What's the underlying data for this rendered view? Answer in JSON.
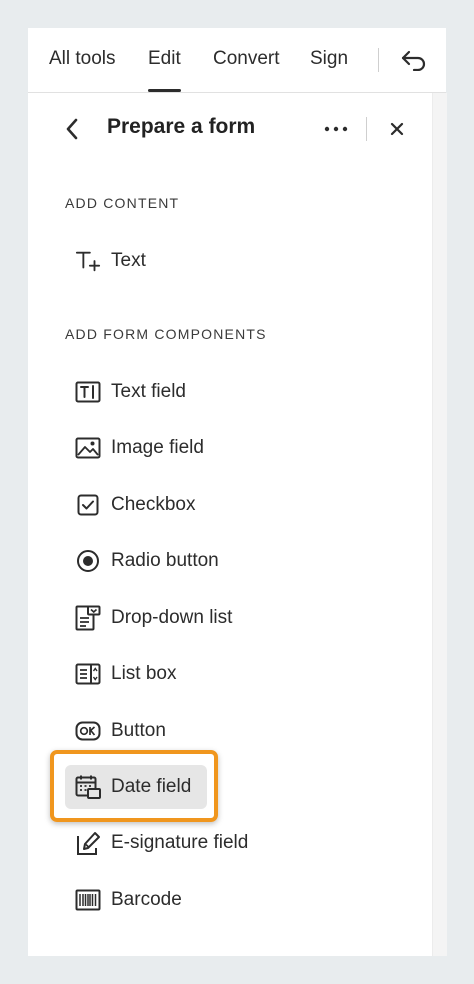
{
  "nav": {
    "tabs": [
      {
        "label": "All tools"
      },
      {
        "label": "Edit",
        "active": true
      },
      {
        "label": "Convert"
      },
      {
        "label": "Sign"
      }
    ],
    "undo_icon": "undo-icon"
  },
  "panel": {
    "title": "Prepare a form",
    "back_icon": "chevron-left-icon",
    "more_icon": "more-horizontal-icon",
    "close_icon": "close-icon"
  },
  "sections": {
    "add_content": {
      "label": "ADD CONTENT",
      "items": [
        {
          "label": "Text",
          "icon": "text-add-icon"
        }
      ]
    },
    "add_form_components": {
      "label": "ADD FORM COMPONENTS",
      "items": [
        {
          "label": "Text field",
          "icon": "text-field-icon"
        },
        {
          "label": "Image field",
          "icon": "image-icon"
        },
        {
          "label": "Checkbox",
          "icon": "checkbox-icon"
        },
        {
          "label": "Radio button",
          "icon": "radio-button-icon"
        },
        {
          "label": "Drop-down list",
          "icon": "dropdown-list-icon"
        },
        {
          "label": "List box",
          "icon": "list-box-icon"
        },
        {
          "label": "Button",
          "icon": "ok-button-icon"
        },
        {
          "label": "Date field",
          "icon": "calendar-icon",
          "selected": true
        },
        {
          "label": "E-signature field",
          "icon": "signature-pen-icon"
        },
        {
          "label": "Barcode",
          "icon": "barcode-icon"
        }
      ]
    }
  },
  "colors": {
    "highlight": "#f0961e",
    "selected_bg": "#e6e6e6",
    "text": "#2c2c2c"
  }
}
